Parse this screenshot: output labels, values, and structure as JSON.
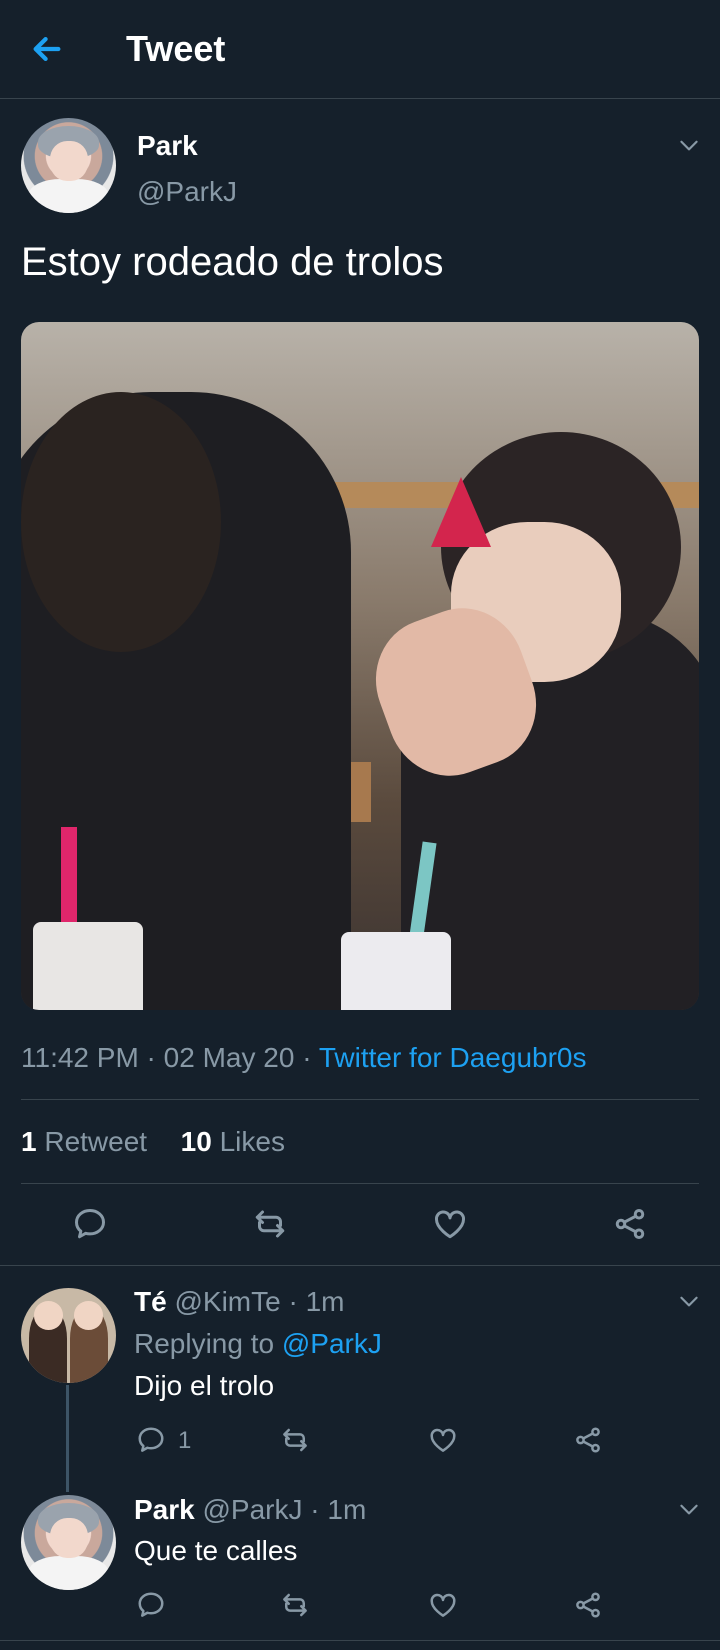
{
  "header": {
    "title": "Tweet"
  },
  "tweet": {
    "author_name": "Park",
    "author_handle": "@ParkJ",
    "text": "Estoy rodeado de trolos",
    "time": "11:42 PM",
    "date": "02 May 20",
    "source": "Twitter for Daegubr0s",
    "retweets_count": "1",
    "retweets_label": "Retweet",
    "likes_count": "10",
    "likes_label": "Likes"
  },
  "replies": [
    {
      "name": "Té",
      "handle": "@KimTe",
      "time": "1m",
      "replying_label": "Replying to",
      "replying_to": "@ParkJ",
      "text": "Dijo el trolo",
      "reply_count": "1"
    },
    {
      "name": "Park",
      "handle": "@ParkJ",
      "time": "1m",
      "text": "Que te calles"
    }
  ],
  "icons": {
    "back": "arrow-left-icon",
    "caret": "chevron-down-icon",
    "reply": "comment-icon",
    "retweet": "retweet-icon",
    "like": "heart-icon",
    "share": "share-icon"
  },
  "colors": {
    "background": "#15202b",
    "accent": "#1da1f2",
    "muted": "#8899a6",
    "divider": "#38444d"
  }
}
